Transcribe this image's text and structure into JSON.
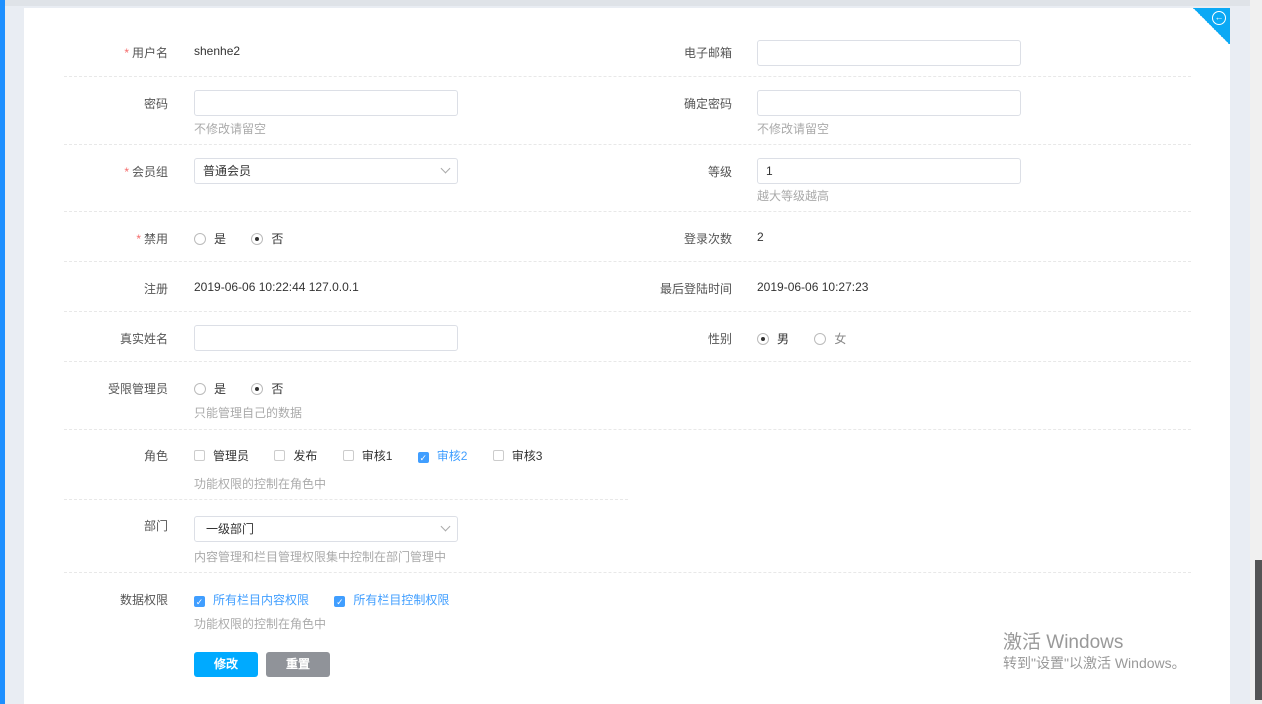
{
  "form": {
    "username": {
      "label": "用户名",
      "value": "shenhe2"
    },
    "email": {
      "label": "电子邮箱",
      "value": ""
    },
    "password": {
      "label": "密码",
      "value": "",
      "hint": "不修改请留空"
    },
    "confirm_password": {
      "label": "确定密码",
      "value": "",
      "hint": "不修改请留空"
    },
    "member_group": {
      "label": "会员组",
      "value": "普通会员"
    },
    "level": {
      "label": "等级",
      "value": "1",
      "hint": "越大等级越高"
    },
    "disabled": {
      "label": "禁用",
      "options": [
        "是",
        "否"
      ],
      "selected": "否"
    },
    "login_count": {
      "label": "登录次数",
      "value": "2"
    },
    "register": {
      "label": "注册",
      "value": "2019-06-06 10:22:44 127.0.0.1"
    },
    "last_login": {
      "label": "最后登陆时间",
      "value": "2019-06-06 10:27:23"
    },
    "real_name": {
      "label": "真实姓名",
      "value": ""
    },
    "gender": {
      "label": "性别",
      "options": [
        "男",
        "女"
      ],
      "selected": "男"
    },
    "limited_admin": {
      "label": "受限管理员",
      "options": [
        "是",
        "否"
      ],
      "selected": "否",
      "hint": "只能管理自己的数据"
    },
    "roles": {
      "label": "角色",
      "options": [
        {
          "label": "管理员",
          "checked": false
        },
        {
          "label": "发布",
          "checked": false
        },
        {
          "label": "审核1",
          "checked": false
        },
        {
          "label": "审核2",
          "checked": true
        },
        {
          "label": "审核3",
          "checked": false
        }
      ],
      "hint": "功能权限的控制在角色中"
    },
    "department": {
      "label": "部门",
      "value": "一级部门",
      "hint": "内容管理和栏目管理权限集中控制在部门管理中"
    },
    "data_permission": {
      "label": "数据权限",
      "options": [
        {
          "label": "所有栏目内容权限",
          "checked": true
        },
        {
          "label": "所有栏目控制权限",
          "checked": true
        }
      ],
      "hint": "功能权限的控制在角色中"
    },
    "submit_label": "修改",
    "reset_label": "重置"
  },
  "watermark": {
    "title": "激活 Windows",
    "subtitle": "转到\"设置\"以激活 Windows。"
  },
  "colors": {
    "primary": "#00aaff",
    "reset": "#909399",
    "accent": "#409eff"
  }
}
